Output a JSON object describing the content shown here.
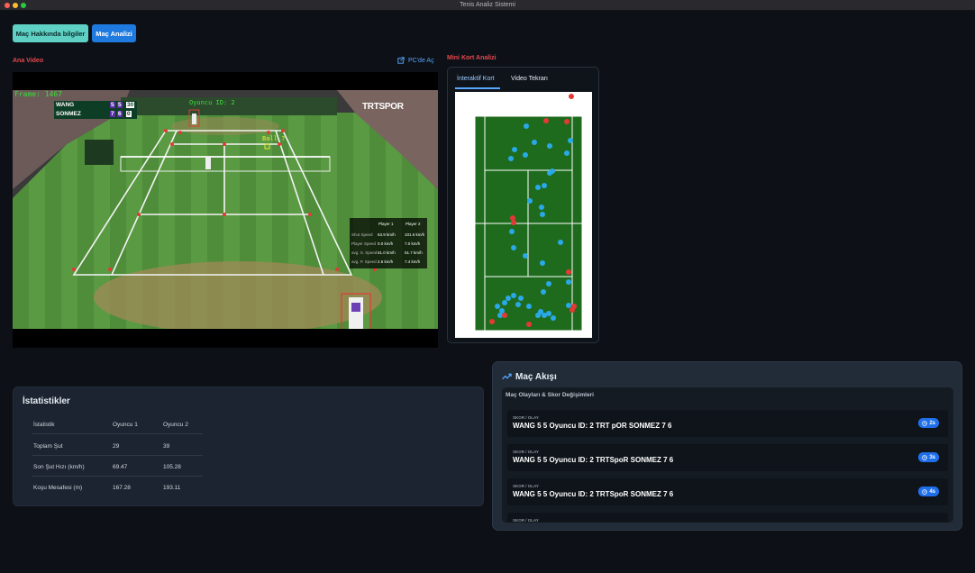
{
  "window": {
    "title": "Tenis Analiz Sistemi"
  },
  "toolbar": {
    "info_label": "Maç Hakkında bilgiler",
    "analysis_label": "Maç Analizi"
  },
  "video": {
    "section_label": "Ana Video",
    "open_pc_label": "PC'de Aç",
    "frame_label": "Frame: 1467",
    "player_label": "Oyuncu ID: 2",
    "ball_label": "Ball ?",
    "scoreboard": {
      "rows": [
        {
          "name": "WANG",
          "s1": "5",
          "s2": "5",
          "pts": "30"
        },
        {
          "name": "SONMEZ",
          "s1": "7",
          "s2": "6",
          "pts": "0"
        }
      ]
    },
    "broadcaster": "TRTSPOR",
    "overlay": {
      "headers": [
        "",
        "Player 1",
        "Player 2"
      ],
      "rows": [
        [
          "Shot Speed",
          "63.9 km/h",
          "101.6 km/h"
        ],
        [
          "Player Speed",
          "0.0 km/h",
          "7.0 km/h"
        ],
        [
          "avg. S. Speed",
          "61.0 km/h",
          "51.7 km/h"
        ],
        [
          "avg. P. Speed",
          "2.6 km/h",
          "7.4 km/h"
        ]
      ]
    }
  },
  "mini": {
    "section_label": "Mini Kort Analizi",
    "tabs": [
      "İnteraktif Kort",
      "Video Tekrarı"
    ]
  },
  "stats": {
    "title": "İstatistikler",
    "headers": [
      "İstatistik",
      "Oyuncu 1",
      "Oyuncu 2"
    ],
    "rows": [
      [
        "Toplam Şut",
        "29",
        "39"
      ],
      [
        "Son Şut Hızı (km/h)",
        "69.47",
        "105.28"
      ],
      [
        "Koşu Mesafesi (m)",
        "167.28",
        "193.11"
      ]
    ]
  },
  "flow": {
    "title": "Maç Akışı",
    "subtitle": "Maç Olayları & Skor Değişimleri",
    "events": [
      {
        "kind": "SKOR / OLAY",
        "text": "WANG 5 5 Oyuncu ID: 2 TRT pOR SONMEZ 7 6",
        "duration": "2s"
      },
      {
        "kind": "SKOR / OLAY",
        "text": "WANG 5 5 Oyuncu ID: 2 TRTSpoR SONMEZ 7 6",
        "duration": "3s"
      },
      {
        "kind": "SKOR / OLAY",
        "text": "WANG 5 5 Oyuncu ID: 2 TRTSpoR SONMEZ 7 6",
        "duration": "4s"
      },
      {
        "kind": "SKOR / OLAY",
        "text": "",
        "duration": ""
      }
    ]
  },
  "colors": {
    "accent_blue": "#1f7ae0",
    "accent_teal": "#5fd0c4",
    "label_red": "#e5484d",
    "court_green": "#1e6b1e",
    "dot_blue": "#2aa8e8",
    "dot_red": "#e53935"
  }
}
